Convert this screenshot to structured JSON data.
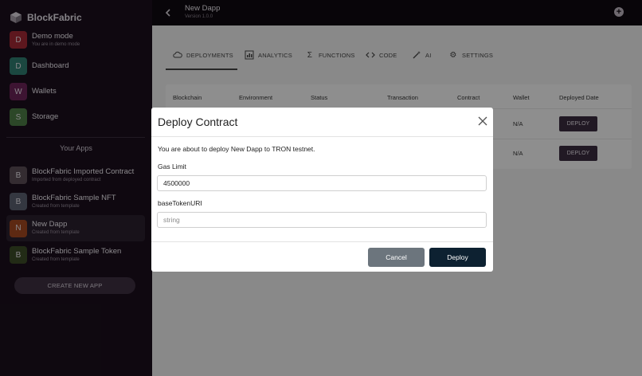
{
  "brand": {
    "name": "BlockFabric",
    "icon": "cube-icon"
  },
  "sidebar": {
    "items": [
      {
        "initial": "D",
        "label": "Demo mode",
        "sub": "You are in demo mode",
        "color": "#a02834"
      },
      {
        "initial": "D",
        "label": "Dashboard",
        "sub": "",
        "color": "#2f7a6e"
      },
      {
        "initial": "W",
        "label": "Wallets",
        "sub": "",
        "color": "#6a2356"
      },
      {
        "initial": "S",
        "label": "Storage",
        "sub": "",
        "color": "#4d7a45"
      }
    ],
    "section_title": "Your Apps",
    "apps": [
      {
        "initial": "B",
        "label": "BlockFabric Imported Contract",
        "sub": "Imported from deployed contract",
        "color": "#5a4d55"
      },
      {
        "initial": "B",
        "label": "BlockFabric Sample NFT",
        "sub": "Created from template",
        "color": "#5a5f6e"
      },
      {
        "initial": "N",
        "label": "New Dapp",
        "sub": "Created from template",
        "color": "#a0471f",
        "active": true
      },
      {
        "initial": "B",
        "label": "BlockFabric Sample Token",
        "sub": "Created from template",
        "color": "#3c4a26"
      }
    ],
    "create_label": "CREATE NEW APP"
  },
  "header": {
    "title": "New Dapp",
    "version": "Version 1.0.0",
    "back_icon": "chevron-left-icon",
    "add_icon": "plus-circle-icon"
  },
  "tabs": [
    {
      "label": "DEPLOYMENTS",
      "icon": "cloud-icon",
      "active": true
    },
    {
      "label": "ANALYTICS",
      "icon": "chart-icon"
    },
    {
      "label": "FUNCTIONS",
      "icon": "sigma-icon"
    },
    {
      "label": "CODE",
      "icon": "code-icon"
    },
    {
      "label": "AI",
      "icon": "magic-wand-icon"
    },
    {
      "label": "SETTINGS",
      "icon": "gear-icon"
    }
  ],
  "table": {
    "headers": [
      "Blockchain",
      "Environment",
      "Status",
      "Transaction",
      "Contract",
      "Wallet",
      "Deployed Date"
    ],
    "rows": [
      {
        "wallet": "N/A",
        "action": "DEPLOY"
      },
      {
        "wallet": "N/A",
        "action": "DEPLOY"
      }
    ]
  },
  "modal": {
    "title": "Deploy Contract",
    "message": "You are about to deploy New Dapp to TRON testnet.",
    "gas_label": "Gas Limit",
    "gas_value": "4500000",
    "uri_label": "baseTokenURI",
    "uri_placeholder": "string",
    "cancel_label": "Cancel",
    "deploy_label": "Deploy"
  },
  "colors": {
    "sidebar_bg": "#1a0f1c",
    "topbar_bg": "#0e0a10",
    "primary": "#0d2131",
    "secondary": "#6c757d",
    "accent": "#3a2c3e"
  }
}
